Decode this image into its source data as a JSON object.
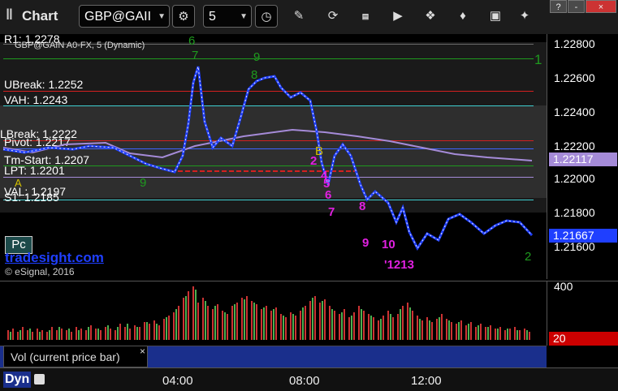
{
  "toolbar": {
    "title": "Chart",
    "symbol": "GBP@GAII",
    "interval": "5",
    "window_controls": [
      "?",
      "-",
      "×"
    ]
  },
  "chart_header": "GBP@GAIN A0-FX, 5 (Dynamic)",
  "watermark": {
    "site": "tradesight.com",
    "copyright": "© eSignal, 2016",
    "badge": "Pc"
  },
  "levels": [
    {
      "label": "R1: 1.2278",
      "value": 1.2278,
      "color": "#cfcfcf"
    },
    {
      "label": "UBreak: 1.2252",
      "value": 1.2252,
      "color": "#d42020"
    },
    {
      "label": "VAH: 1.2243",
      "value": 1.2243,
      "color": "#3fcfd0"
    },
    {
      "label": "LBreak: 1.2222",
      "value": 1.2222,
      "color": "#d42020"
    },
    {
      "label": "Pivot: 1.2217",
      "value": 1.2217,
      "color": "#3e63ff"
    },
    {
      "label": "Tm-Start: 1.2207",
      "value": 1.2207,
      "color": "#1f9a1f"
    },
    {
      "label": "LPT: 1.2201",
      "value": 1.2201,
      "color": "#d42020"
    },
    {
      "label": "VAL: 1.2197",
      "value": 1.2197,
      "color": "#3fcfd0"
    },
    {
      "label": "S1: 1.2185",
      "value": 1.2185,
      "color": "#3fcfd0"
    }
  ],
  "price_axis": {
    "ticks": [
      "1.22800",
      "1.22600",
      "1.22400",
      "1.22200",
      "1.22000",
      "1.21800",
      "1.21600"
    ],
    "badges": [
      {
        "text": "1.22117",
        "color": "#a58bd8"
      },
      {
        "text": "1.21667",
        "color": "#1f3fff"
      }
    ]
  },
  "counts": [
    {
      "text": "6",
      "color": "#1f9a1f"
    },
    {
      "text": "7",
      "color": "#1f9a1f"
    },
    {
      "text": "9",
      "color": "#1f9a1f"
    },
    {
      "text": "8",
      "color": "#1f9a1f"
    },
    {
      "text": "9",
      "color": "#1f9a1f"
    },
    {
      "text": "1",
      "color": "#1f9a1f"
    },
    {
      "text": "A",
      "color": "#d4c000"
    },
    {
      "text": "B",
      "color": "#d4c000"
    },
    {
      "text": "2",
      "color": "#e020e0"
    },
    {
      "text": "4",
      "color": "#e020e0"
    },
    {
      "text": "5",
      "color": "#e020e0"
    },
    {
      "text": "6",
      "color": "#e020e0"
    },
    {
      "text": "7",
      "color": "#e020e0"
    },
    {
      "text": "8",
      "color": "#e020e0"
    },
    {
      "text": "9",
      "color": "#e020e0"
    },
    {
      "text": "10",
      "color": "#e020e0"
    },
    {
      "text": "'1213",
      "color": "#e020e0"
    },
    {
      "text": "2",
      "color": "#1f9a1f"
    }
  ],
  "volume": {
    "label": "Vol (current price bar)",
    "close": "×",
    "axis_top": "400",
    "current": "20"
  },
  "time_axis": {
    "mode": "Dyn",
    "labels": [
      "04:00",
      "08:00",
      "12:00"
    ]
  }
}
